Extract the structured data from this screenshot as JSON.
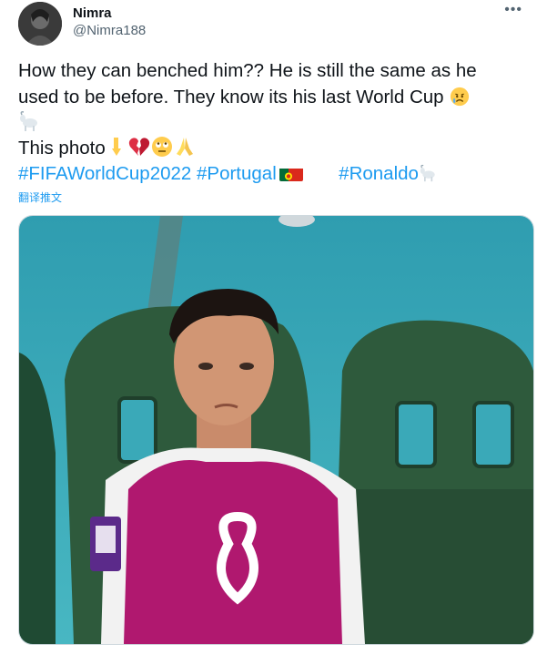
{
  "author": {
    "name": "Nimra",
    "handle": "@Nimra188"
  },
  "menu": {
    "more_label": "•••"
  },
  "tweet": {
    "line1": "How they can benched him?? He is still the same as he",
    "line2": "used to be before. They know its his last World Cup",
    "line3": "This photo",
    "hashtags": [
      "#FIFAWorldCup2022",
      "#Portugal",
      "#Ronaldo"
    ]
  },
  "translate_label": "翻译推文",
  "icons": {
    "line2_end": "crying-face",
    "line2b": "goat",
    "line3": [
      "point-down",
      "broken-heart",
      "rolling-eyes",
      "pray"
    ],
    "flag": "portugal-flag",
    "ronaldo_suffix": "goat"
  },
  "colors": {
    "hashtag": "#1d9bf0",
    "handle": "#536471",
    "seat": "#2e5a3c",
    "bib": "#b0186f",
    "background": "#3aa9b8"
  }
}
